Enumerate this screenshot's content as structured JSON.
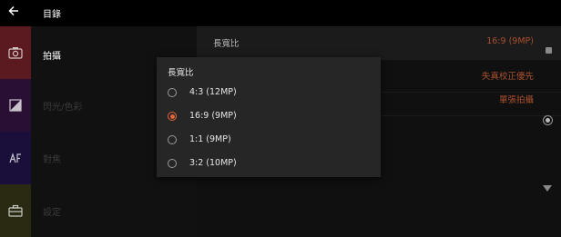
{
  "app_bar": {
    "title": "目錄"
  },
  "categories": [
    {
      "label": "拍攝"
    },
    {
      "label": "閃光/色彩"
    },
    {
      "label": "對焦"
    },
    {
      "label": "設定"
    }
  ],
  "settings": [
    {
      "label": "長寬比",
      "value": "16:9 (9MP)"
    },
    {
      "label": "",
      "value": "失真校正優先"
    },
    {
      "label": "",
      "value": "單張拍攝"
    }
  ],
  "dialog": {
    "title": "長寬比",
    "options": [
      {
        "label": "4:3 (12MP)",
        "selected": false
      },
      {
        "label": "16:9 (9MP)",
        "selected": true
      },
      {
        "label": "1:1 (9MP)",
        "selected": false
      },
      {
        "label": "3:2 (10MP)",
        "selected": false
      }
    ]
  },
  "colors": {
    "accent": "#e2663b",
    "value_text": "#a9502e"
  }
}
